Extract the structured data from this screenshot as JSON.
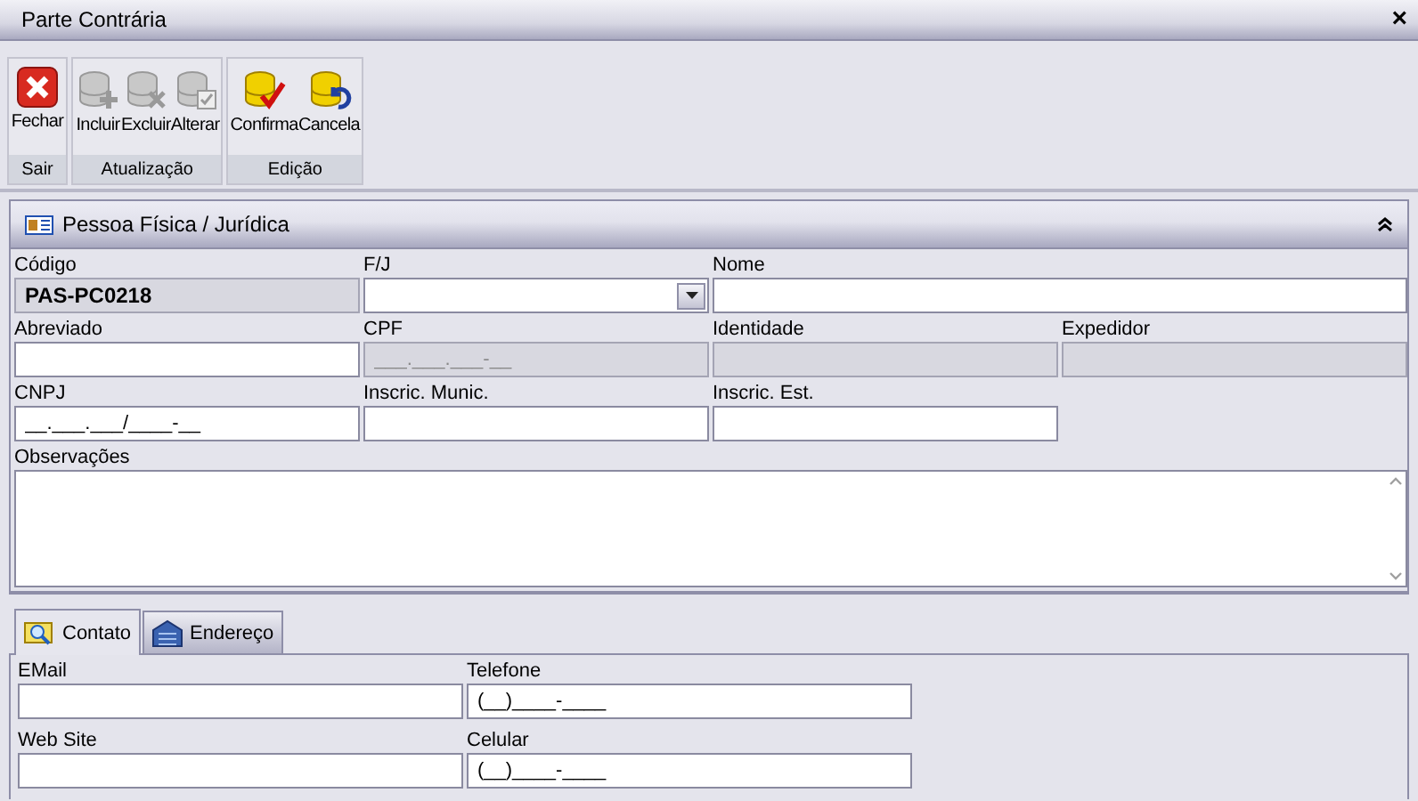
{
  "window": {
    "title": "Parte Contrária",
    "close": "×"
  },
  "toolbar": [
    {
      "label": "Sair",
      "buttons": [
        {
          "label": "Fechar",
          "kind": "close",
          "disabled": false
        }
      ]
    },
    {
      "label": "Atualização",
      "buttons": [
        {
          "label": "Incluir",
          "kind": "add",
          "disabled": true
        },
        {
          "label": "Excluir",
          "kind": "delete",
          "disabled": true
        },
        {
          "label": "Alterar",
          "kind": "edit",
          "disabled": true
        }
      ]
    },
    {
      "label": "Edição",
      "buttons": [
        {
          "label": "Confirma",
          "kind": "confirm",
          "disabled": false
        },
        {
          "label": "Cancela",
          "kind": "cancel",
          "disabled": false
        }
      ]
    }
  ],
  "section": {
    "title": "Pessoa Física / Jurídica",
    "expanded": true
  },
  "form_rows": [
    [
      {
        "label": "Código",
        "value": "PAS-PC0218",
        "kind": "code",
        "disabled": true
      },
      {
        "label": "F/J",
        "kind": "select",
        "disabled": false
      },
      {
        "label": "Nome",
        "kind": "wide",
        "disabled": false
      }
    ],
    [
      {
        "label": "Abreviado",
        "kind": "text",
        "disabled": false
      },
      {
        "label": "CPF",
        "value": "___.___.___-__",
        "kind": "text",
        "disabled": true
      },
      {
        "label": "Identidade",
        "kind": "text",
        "disabled": true
      },
      {
        "label": "Expedidor",
        "kind": "text",
        "disabled": true
      }
    ],
    [
      {
        "label": "CNPJ",
        "value": "__.___.___/____-__",
        "kind": "text",
        "disabled": false
      },
      {
        "label": "Inscric. Munic.",
        "kind": "text",
        "disabled": false
      },
      {
        "label": "Inscric. Est.",
        "kind": "text",
        "disabled": false
      }
    ]
  ],
  "notes": {
    "label": "Observações"
  },
  "tabs": [
    {
      "label": "Contato",
      "kind": "contact",
      "selected": true
    },
    {
      "label": "Endereço",
      "kind": "building",
      "selected": false
    }
  ],
  "contact_rows": [
    [
      {
        "label": "EMail"
      },
      {
        "label": "Telefone",
        "value": "(__)____-____"
      }
    ],
    [
      {
        "label": "Web Site"
      },
      {
        "label": "Celular",
        "value": "(__)____-____"
      }
    ]
  ]
}
